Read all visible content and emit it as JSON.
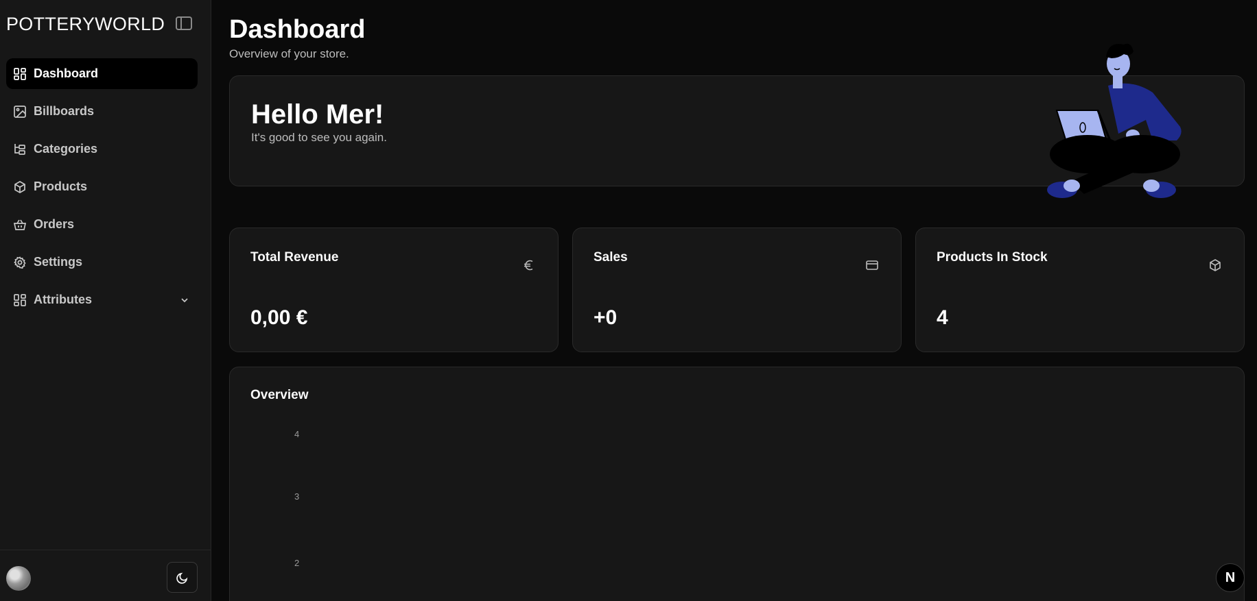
{
  "sidebar": {
    "brand": "POTTERYWORLD",
    "items": [
      {
        "label": "Dashboard",
        "icon": "layout-dashboard-icon",
        "active": true
      },
      {
        "label": "Billboards",
        "icon": "image-icon"
      },
      {
        "label": "Categories",
        "icon": "folder-tree-icon"
      },
      {
        "label": "Products",
        "icon": "package-icon"
      },
      {
        "label": "Orders",
        "icon": "shopping-basket-icon"
      },
      {
        "label": "Settings",
        "icon": "gear-icon"
      },
      {
        "label": "Attributes",
        "icon": "layout-dashboard-icon",
        "expandable": true
      }
    ]
  },
  "header": {
    "title": "Dashboard",
    "subtitle": "Overview of your store."
  },
  "greeting": {
    "title": "Hello Mer!",
    "subtitle": "It's good to see you again."
  },
  "stats": [
    {
      "title": "Total Revenue",
      "value": "0,00 €",
      "icon": "euro-icon"
    },
    {
      "title": "Sales",
      "value": "+0",
      "icon": "credit-card-icon"
    },
    {
      "title": "Products In Stock",
      "value": "4",
      "icon": "package-icon"
    }
  ],
  "overview": {
    "title": "Overview",
    "ticks": [
      "4",
      "3",
      "2"
    ]
  },
  "badge": {
    "label": "N"
  },
  "colors": {
    "accent": "#1e2a8c",
    "background": "#0a0a0a",
    "card": "#171717"
  }
}
